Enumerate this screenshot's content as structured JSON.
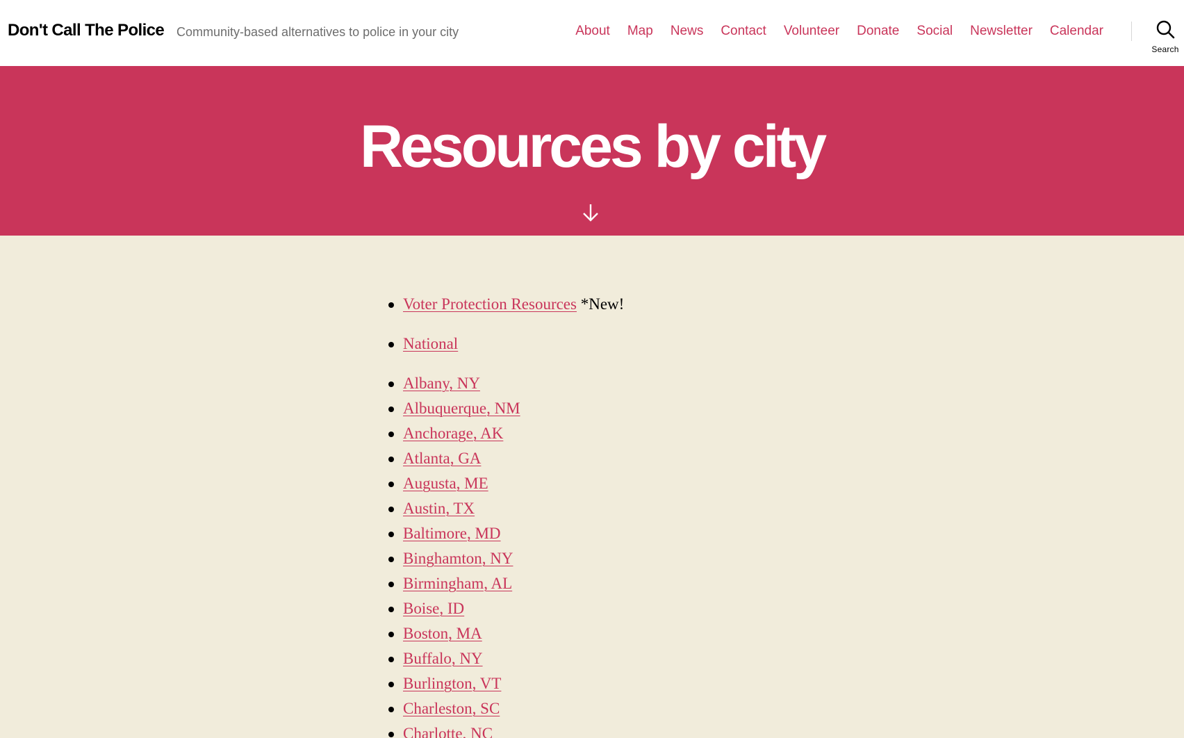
{
  "header": {
    "site_title": "Don't Call The Police",
    "site_description": "Community-based alternatives to police in your city",
    "nav": [
      "About",
      "Map",
      "News",
      "Contact",
      "Volunteer",
      "Donate",
      "Social",
      "Newsletter",
      "Calendar"
    ],
    "search_label": "Search"
  },
  "hero": {
    "title": "Resources by city"
  },
  "resources": {
    "featured": {
      "label": "Voter Protection Resources",
      "note": "*New!"
    },
    "national": "National",
    "cities": [
      "Albany, NY",
      "Albuquerque, NM",
      "Anchorage, AK",
      "Atlanta, GA",
      "Augusta, ME",
      "Austin, TX",
      "Baltimore, MD",
      "Binghamton, NY",
      "Birmingham, AL",
      "Boise, ID",
      "Boston, MA",
      "Buffalo, NY",
      "Burlington, VT",
      "Charleston, SC",
      "Charlotte, NC"
    ]
  },
  "colors": {
    "accent": "#c9355a",
    "background": "#f1ecdb",
    "header_bg": "#ffffff"
  }
}
